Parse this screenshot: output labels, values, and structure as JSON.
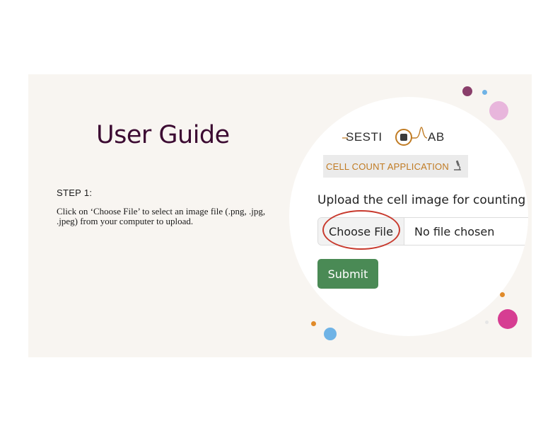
{
  "slide": {
    "title": "User Guide",
    "step_label": "STEP 1:",
    "step_text": "Click on ‘Choose File’ to select an image file (.png, .jpg, .jpeg) from your computer to upload."
  },
  "app": {
    "logo_text_left": "SESTI",
    "logo_text_right": "AB",
    "badge_text": "CELL COUNT APPLICATION",
    "badge_icon": "microscope-icon",
    "upload_label": "Upload the cell image for counting",
    "choose_file_label": "Choose File",
    "file_status": "No file chosen",
    "submit_label": "Submit"
  },
  "colors": {
    "title": "#3c0b32",
    "accent_orange": "#c07b23",
    "submit_green": "#4a8a55",
    "highlight_red": "#c83a2e",
    "dot_purple": "#8a3f6b",
    "dot_pink": "#d63d92",
    "dot_light_pink": "#e8b6dc",
    "dot_blue": "#6fb3e6",
    "dot_orange": "#e08a2a"
  }
}
